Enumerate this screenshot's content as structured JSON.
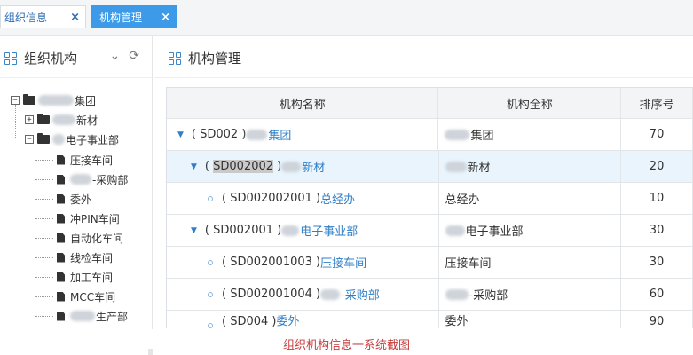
{
  "tabs": [
    {
      "label": "组织信息",
      "close": "×"
    },
    {
      "label": "机构管理",
      "close": "×"
    }
  ],
  "left_panel": {
    "title": "组织机构",
    "tools": {
      "collapse": "⌄",
      "refresh": "⟳"
    },
    "tree": [
      {
        "expander": "−",
        "type": "folder",
        "label": "集团"
      },
      {
        "expander": "+",
        "type": "folder",
        "label": "新材"
      },
      {
        "expander": "−",
        "type": "folder",
        "label": "电子事业部"
      },
      {
        "type": "file",
        "label": "压接车间"
      },
      {
        "type": "file",
        "label": "-采购部"
      },
      {
        "type": "file",
        "label": "委外"
      },
      {
        "type": "file",
        "label": "冲PIN车间"
      },
      {
        "type": "file",
        "label": "自动化车间"
      },
      {
        "type": "file",
        "label": "线检车间"
      },
      {
        "type": "file",
        "label": "加工车间"
      },
      {
        "type": "file",
        "label": "MCC车间"
      },
      {
        "type": "file",
        "label": "生产部"
      }
    ]
  },
  "right_panel": {
    "title": "机构管理",
    "columns": [
      "机构名称",
      "机构全称",
      "排序号"
    ],
    "rows": [
      {
        "marker": "▼",
        "code_prefix": "( SD002 ) ",
        "code_hl": "",
        "code_suffix": "",
        "name": "集团",
        "full": "集团",
        "sort": "70"
      },
      {
        "marker": "▼",
        "code_prefix": "( ",
        "code_hl": "SD002002",
        "code_suffix": " ) ",
        "name": "新材",
        "full": "新材",
        "sort": "20"
      },
      {
        "marker": "○",
        "code_prefix": "( SD002002001 ) ",
        "code_hl": "",
        "code_suffix": "",
        "name": "总经办",
        "full": "总经办",
        "sort": "10"
      },
      {
        "marker": "▼",
        "code_prefix": "( SD002001 ) ",
        "code_hl": "",
        "code_suffix": "",
        "name": "电子事业部",
        "full": "电子事业部",
        "sort": "30"
      },
      {
        "marker": "○",
        "code_prefix": "( SD002001003 ) ",
        "code_hl": "",
        "code_suffix": "",
        "name": "压接车间",
        "full": "压接车间",
        "sort": "30"
      },
      {
        "marker": "○",
        "code_prefix": "( SD002001004 ) ",
        "code_hl": "",
        "code_suffix": "",
        "name": "-采购部",
        "full": "-采购部",
        "sort": "60"
      },
      {
        "marker": "○",
        "code_prefix": "( SD004 ) ",
        "code_hl": "",
        "code_suffix": "",
        "name": "委外",
        "full": "委外",
        "sort": "90"
      }
    ]
  },
  "caption": "组织机构信息一系统截图",
  "colors": {
    "accent": "#3c9ae8",
    "link": "#2f7fc8",
    "caption": "#c53b3b"
  }
}
